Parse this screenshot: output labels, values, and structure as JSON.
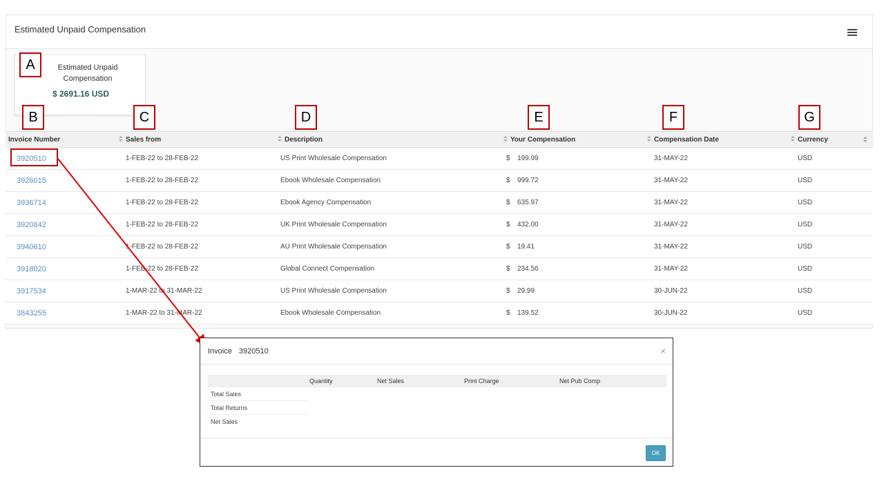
{
  "panel": {
    "title": "Estimated Unpaid Compensation"
  },
  "card": {
    "label": "Estimated Unpaid Compensation",
    "value": "$ 2691.16   USD"
  },
  "callouts": [
    "A",
    "B",
    "C",
    "D",
    "E",
    "F",
    "G"
  ],
  "table": {
    "headers": [
      "Invoice Number",
      "Sales from",
      "Description",
      "Your Compensation",
      "Compensation Date",
      "Currency"
    ],
    "rows": [
      {
        "invoice": "3920510",
        "sales_from": "1-FEB-22 to 28-FEB-22",
        "description": "US Print Wholesale Compensation",
        "currency_symbol": "$",
        "amount": "199.99",
        "date": "31-MAY-22",
        "currency": "USD"
      },
      {
        "invoice": "3926015",
        "sales_from": "1-FEB-22 to 28-FEB-22",
        "description": "Ebook Wholesale Compensation",
        "currency_symbol": "$",
        "amount": "999.72",
        "date": "31-MAY-22",
        "currency": "USD"
      },
      {
        "invoice": "3936714",
        "sales_from": "1-FEB-22 to 28-FEB-22",
        "description": "Ebook Agency Compensation",
        "currency_symbol": "$",
        "amount": "635.97",
        "date": "31-MAY-22",
        "currency": "USD"
      },
      {
        "invoice": "3920842",
        "sales_from": "1-FEB-22 to 28-FEB-22",
        "description": "UK Print Wholesale Compensation",
        "currency_symbol": "$",
        "amount": "432.00",
        "date": "31-MAY-22",
        "currency": "USD"
      },
      {
        "invoice": "3940610",
        "sales_from": "1-FEB-22 to 28-FEB-22",
        "description": "AU Print Wholesale Compensation",
        "currency_symbol": "$",
        "amount": "19.41",
        "date": "31-MAY-22",
        "currency": "USD"
      },
      {
        "invoice": "3918020",
        "sales_from": "1-FEB-22 to 28-FEB-22",
        "description": "Global Connect Compensation",
        "currency_symbol": "$",
        "amount": "234.56",
        "date": "31-MAY-22",
        "currency": "USD"
      },
      {
        "invoice": "3917534",
        "sales_from": "1-MAR-22 to 31-MAR-22",
        "description": "US Print Wholesale Compensation",
        "currency_symbol": "$",
        "amount": "29.99",
        "date": "30-JUN-22",
        "currency": "USD"
      },
      {
        "invoice": "3843255",
        "sales_from": "1-MAR-22 to 31-MAR-22",
        "description": "Ebook Wholesale Compensation",
        "currency_symbol": "$",
        "amount": "139.52",
        "date": "30-JUN-22",
        "currency": "USD"
      }
    ]
  },
  "modal": {
    "title": "Invoice",
    "invoice_number": "3920510",
    "close": "×",
    "columns": [
      "",
      "Quantity",
      "Net Sales",
      "Print Charge",
      "Net Pub Comp"
    ],
    "rows": [
      "Total Sales",
      "Total Returns",
      "Net Sales"
    ],
    "ok_label": "OK"
  },
  "colors": {
    "callout_border": "#c00000",
    "link": "#5a8fc4",
    "ok_button": "#4a9fbf",
    "card_value": "#2f5f5a"
  }
}
